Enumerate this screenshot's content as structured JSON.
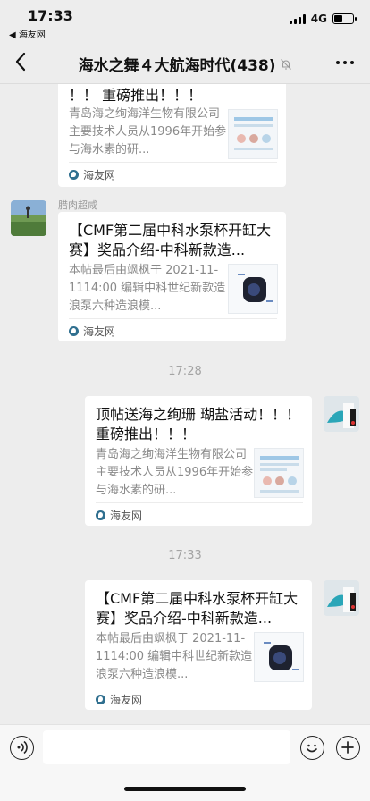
{
  "status": {
    "time": "17:33",
    "back_app": "◀ 海友网",
    "network": "4G"
  },
  "nav": {
    "title": "海水之舞４大航海时代(438)",
    "back_icon": "chevron-left-icon",
    "mute_icon": "mute-bell-icon",
    "more_icon": "more-dots-icon"
  },
  "messages": [
    {
      "type": "card",
      "title": "！！ 重磅推出！！！",
      "desc": "青岛海之绚海洋生物有限公司主要技术人员从1996年开始参与海水素的研...",
      "source": "海友网"
    },
    {
      "type": "card",
      "sender": "腊肉超咸",
      "title": "【CMF第二届中科水泵杯开缸大赛】奖品介绍-中科新款造...",
      "desc": "本帖最后由飒枫于 2021-11-1114:00 编辑中科世纪新款造浪泵六种造浪模...",
      "source": "海友网"
    },
    {
      "type": "time",
      "text": "17:28"
    },
    {
      "type": "card",
      "title": "顶帖送海之绚珊 瑚盐活动！！！ 重磅推出！！！",
      "desc": "青岛海之绚海洋生物有限公司主要技术人员从1996年开始参与海水素的研...",
      "source": "海友网"
    },
    {
      "type": "time",
      "text": "17:33"
    },
    {
      "type": "card",
      "title": "【CMF第二届中科水泵杯开缸大赛】奖品介绍-中科新款造...",
      "desc": "本帖最后由飒枫于 2021-11-1114:00 编辑中科世纪新款造浪泵六种造浪模...",
      "source": "海友网"
    }
  ],
  "input": {
    "voice_icon": "voice-icon",
    "emoji_icon": "emoji-icon",
    "plus_icon": "plus-icon",
    "value": "",
    "placeholder": ""
  },
  "colors": {
    "background": "#ededed",
    "bubble": "#ffffff",
    "meta_text": "#a3a3a3"
  }
}
